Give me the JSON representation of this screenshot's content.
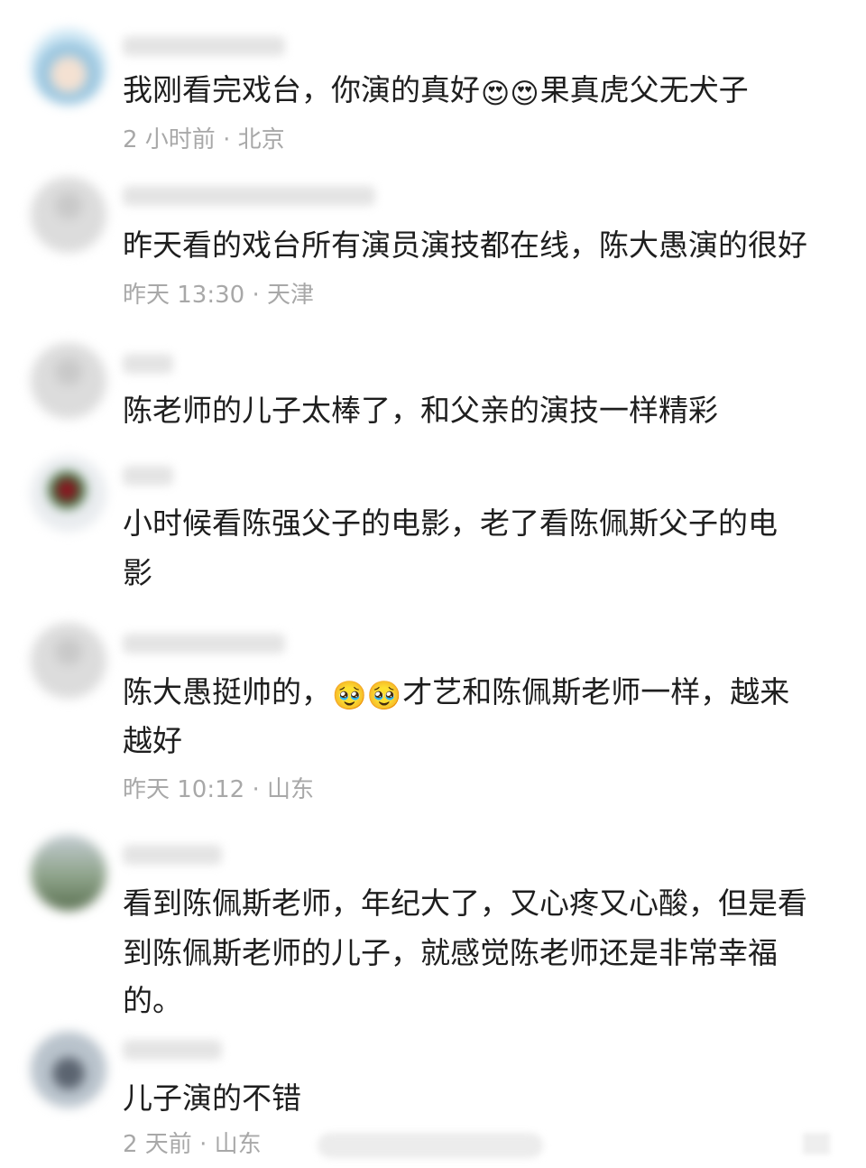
{
  "comments": [
    {
      "text_before": "我刚看完戏台，你演的真好",
      "emojis": "😍😍",
      "text_after": "果真虎父无犬子",
      "meta": "2 小时前 · 北京"
    },
    {
      "text": "昨天看的戏台所有演员演技都在线，陈大愚演的很好",
      "meta": "昨天 13:30 · 天津"
    },
    {
      "text": "陈老师的儿子太棒了，和父亲的演技一样精彩"
    },
    {
      "line1": "小时候看陈强父子的电影，老了看陈佩斯父子的电",
      "line2": "影"
    },
    {
      "text_before": "陈大愚挺帅的，",
      "emojis": "🥹🥹",
      "text_after": "才艺和陈佩斯老师一样，越来",
      "line2": "越好",
      "meta": "昨天 10:12 · 山东"
    },
    {
      "line1": "看到陈佩斯老师，年纪大了，又心疼又心酸，但是看",
      "line2": "到陈佩斯老师的儿子，就感觉陈老师还是非常幸福",
      "line3": "的。"
    },
    {
      "text": "儿子演的不错",
      "meta": "2 天前 · 山东"
    }
  ]
}
